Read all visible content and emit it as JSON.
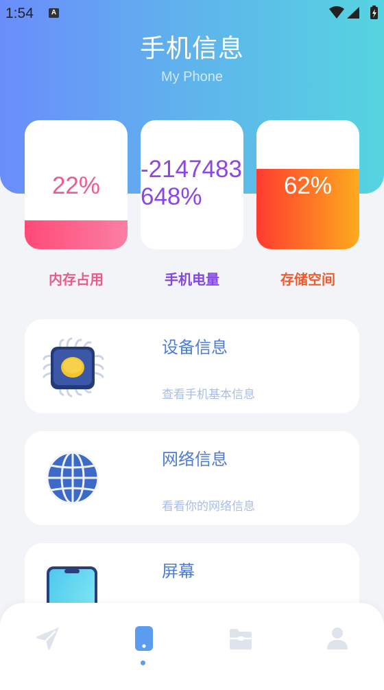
{
  "status_bar": {
    "time": "1:54",
    "notif_glyph": "A",
    "icons": [
      "wifi-icon",
      "signal-icon",
      "battery-charging-icon"
    ]
  },
  "header": {
    "title": "手机信息",
    "subtitle": "My Phone"
  },
  "stats": [
    {
      "value": "22%",
      "label": "内存占用",
      "fill_level": 0.22,
      "color": "#ee5c8a",
      "label_color": "#ea5b88"
    },
    {
      "value": "-2147483648%",
      "label": "手机电量",
      "color": "#8a46e6",
      "label_color": "#8248e0"
    },
    {
      "value": "62%",
      "label": "存储空间",
      "fill_level": 0.62,
      "color": "#ff3b30",
      "label_color": "#f05a2a"
    }
  ],
  "menu": [
    {
      "title": "设备信息",
      "desc": "查看手机基本信息",
      "icon": "chip-icon"
    },
    {
      "title": "网络信息",
      "desc": "看看你的网络信息",
      "icon": "globe-icon"
    },
    {
      "title": "屏幕",
      "desc": "",
      "icon": "phone-screen-icon"
    }
  ],
  "tabbar": {
    "items": [
      "send-icon",
      "phone-icon",
      "folder-icon",
      "user-icon"
    ],
    "active_index": 1,
    "colors": {
      "active": "#5b9bf0",
      "inactive": "#dfe3ec"
    }
  }
}
